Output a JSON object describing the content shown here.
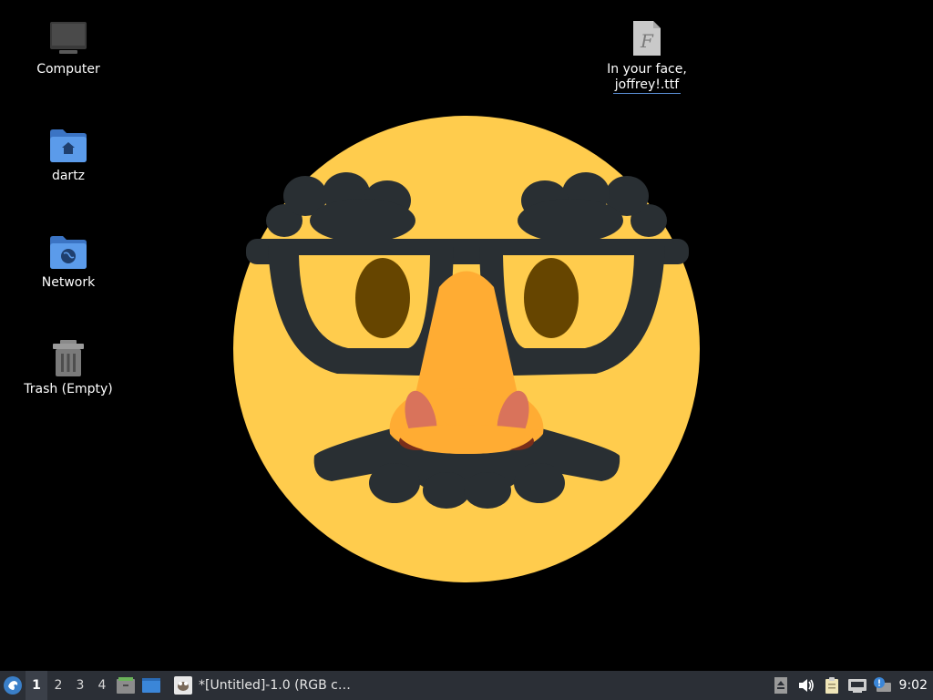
{
  "desktop": {
    "icons": [
      {
        "label": "Computer",
        "icon": "computer-icon"
      },
      {
        "label": "dartz",
        "icon": "home-folder-icon"
      },
      {
        "label": "Network",
        "icon": "network-folder-icon"
      },
      {
        "label": "Trash (Empty)",
        "icon": "trash-icon"
      }
    ],
    "file": {
      "label_line1": "In your face,",
      "label_line2": "joffrey!.ttf",
      "icon": "font-file-icon"
    },
    "wallpaper": {
      "subject": "disguise-face-emoji",
      "colors": {
        "face": "#FFCC4D",
        "glasses": "#292F33",
        "nose": "#FFAC33",
        "eyes": "#664500"
      }
    }
  },
  "taskbar": {
    "menu_icon": "whisker-menu-icon",
    "workspaces": [
      "1",
      "2",
      "3",
      "4"
    ],
    "active_workspace": "1",
    "launchers": [
      "file-manager-icon",
      "show-desktop-icon"
    ],
    "task_label": "*[Untitled]-1.0 (RGB c…",
    "task_icon": "gimp-icon",
    "tray": [
      "eject-icon",
      "volume-icon",
      "clipboard-icon",
      "network-icon",
      "notification-icon"
    ],
    "clock": "9:02"
  }
}
